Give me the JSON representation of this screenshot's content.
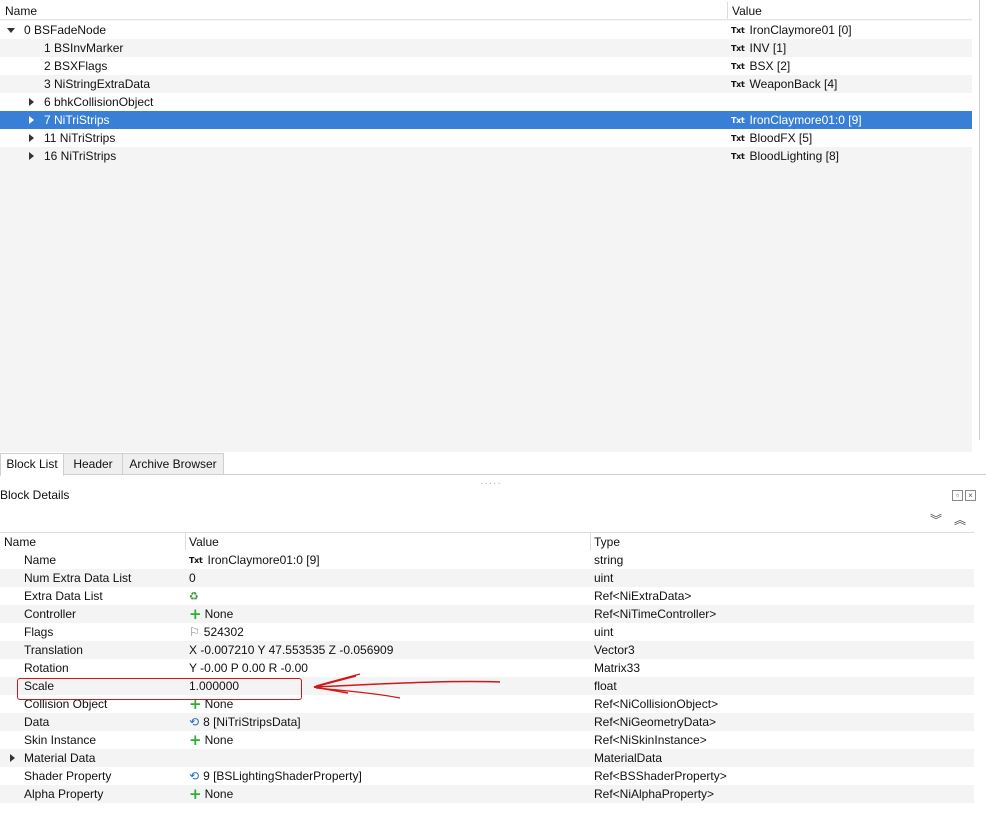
{
  "tree": {
    "columns": {
      "name": "Name",
      "value": "Value"
    },
    "rows": [
      {
        "label": "0 BSFadeNode",
        "value": "IronClaymore01 [0]",
        "icon": "txt-icon"
      },
      {
        "label": "1 BSInvMarker",
        "value": "INV [1]",
        "icon": "txt-icon"
      },
      {
        "label": "2 BSXFlags",
        "value": "BSX [2]",
        "icon": "txt-icon"
      },
      {
        "label": "3 NiStringExtraData",
        "value": "WeaponBack [4]",
        "icon": "txt-icon"
      },
      {
        "label": "6 bhkCollisionObject",
        "value": ""
      },
      {
        "label": "7 NiTriStrips",
        "value": "IronClaymore01:0 [9]",
        "icon": "txt-icon"
      },
      {
        "label": "11 NiTriStrips",
        "value": "BloodFX [5]",
        "icon": "txt-icon"
      },
      {
        "label": "16 NiTriStrips",
        "value": "BloodLighting [8]",
        "icon": "txt-icon"
      }
    ],
    "txt_label": "Txt"
  },
  "tabs": [
    "Block List",
    "Header",
    "Archive Browser"
  ],
  "block_details": {
    "title": "Block Details",
    "columns": {
      "name": "Name",
      "value": "Value",
      "type": "Type"
    },
    "rows": [
      {
        "name": "Name",
        "value": "IronClaymore01:0 [9]",
        "type": "string",
        "icon": "txt-icon"
      },
      {
        "name": "Num Extra Data List",
        "value": "0",
        "type": "uint"
      },
      {
        "name": "Extra Data List",
        "value": "",
        "type": "Ref<NiExtraData>",
        "icon": "list-icon"
      },
      {
        "name": "Controller",
        "value": "None",
        "type": "Ref<NiTimeController>",
        "icon": "plus-icon"
      },
      {
        "name": "Flags",
        "value": "524302",
        "type": "uint",
        "icon": "flag-icon"
      },
      {
        "name": "Translation",
        "value": "X -0.007210 Y 47.553535 Z -0.056909",
        "type": "Vector3"
      },
      {
        "name": "Rotation",
        "value": "Y -0.00 P 0.00 R -0.00",
        "type": "Matrix33"
      },
      {
        "name": "Scale",
        "value": "1.000000",
        "type": "float"
      },
      {
        "name": "Collision Object",
        "value": "None",
        "type": "Ref<NiCollisionObject>",
        "icon": "plus-icon"
      },
      {
        "name": "Data",
        "value": "8 [NiTriStripsData]",
        "type": "Ref<NiGeometryData>",
        "icon": "ref-icon"
      },
      {
        "name": "Skin Instance",
        "value": "None",
        "type": "Ref<NiSkinInstance>",
        "icon": "plus-icon"
      },
      {
        "name": "Material Data",
        "value": "",
        "type": "MaterialData"
      },
      {
        "name": "Shader Property",
        "value": "9 [BSLightingShaderProperty]",
        "type": "Ref<BSShaderProperty>",
        "icon": "ref-icon"
      },
      {
        "name": "Alpha Property",
        "value": "None",
        "type": "Ref<NiAlphaProperty>",
        "icon": "plus-icon"
      }
    ]
  },
  "colors": {
    "selection": "#3a7fd6",
    "annotation": "#d01818",
    "plus": "#2fae2f"
  }
}
